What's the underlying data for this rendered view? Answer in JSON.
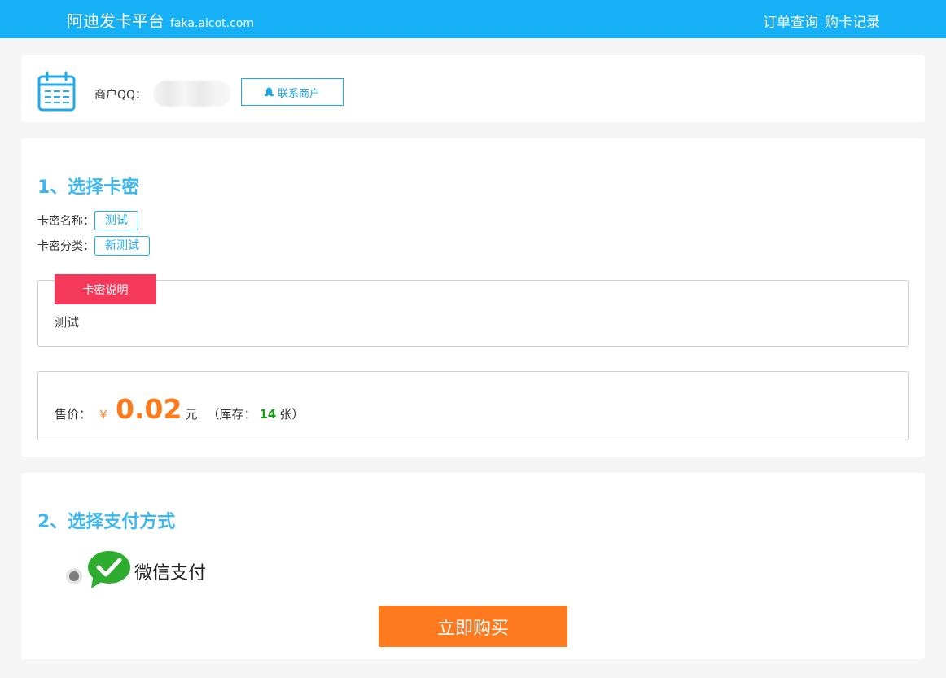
{
  "header": {
    "brand_name": "阿迪发卡平台",
    "brand_domain": "faka.aicot.com",
    "nav": [
      {
        "label": "订单查询"
      },
      {
        "label": "购卡记录"
      }
    ]
  },
  "merchant": {
    "qq_label": "商户QQ：",
    "contact_button": "联系商户"
  },
  "section1": {
    "title": "1、选择卡密",
    "name_label": "卡密名称：",
    "name_value": "测试",
    "category_label": "卡密分类：",
    "category_value": "新测试",
    "description_tab": "卡密说明",
    "description_text": "测试",
    "price_label": "售价：",
    "currency_symbol": "￥",
    "price": "0.02",
    "unit": "元",
    "stock_prefix": "（库存：",
    "stock_count": "14",
    "stock_suffix": "张）"
  },
  "section2": {
    "title": "2、选择支付方式",
    "payment_method": "微信支付",
    "buy_button": "立即购买"
  },
  "colors": {
    "topbar": "#16b0f6",
    "accent": "#1ea7e8",
    "section_title": "#3fb7ec",
    "price": "#ff7a1a",
    "tab": "#f5395a",
    "stock": "#1a9a1a",
    "buy_button": "#ff7a1f",
    "wechat": "#2dac2f"
  }
}
